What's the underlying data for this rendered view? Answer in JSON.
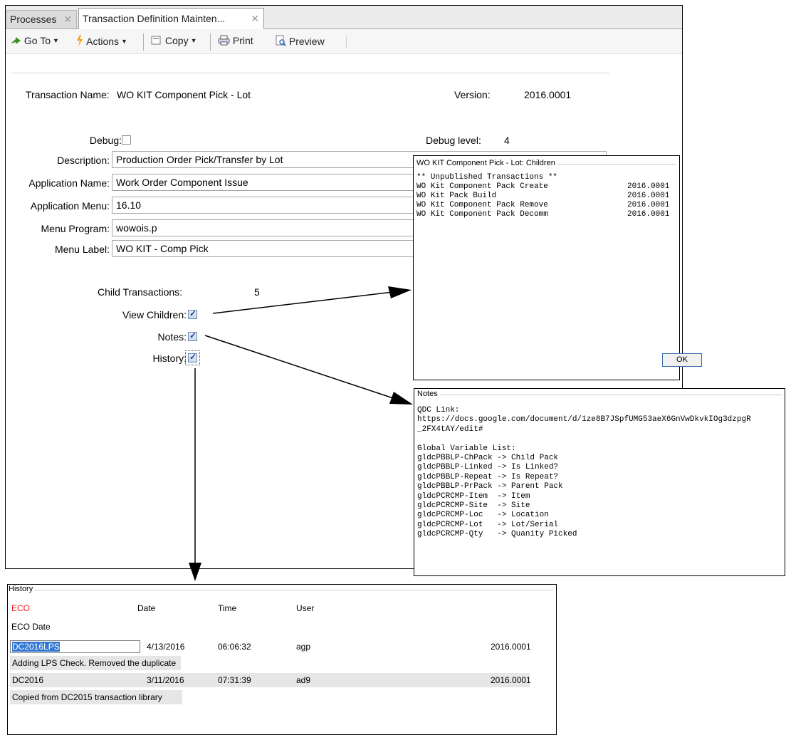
{
  "tabs": [
    {
      "label": "Processes"
    },
    {
      "label": "Transaction Definition Mainten..."
    }
  ],
  "toolbar": {
    "goto_label": "Go To",
    "actions_label": "Actions",
    "copy_label": "Copy",
    "print_label": "Print",
    "preview_label": "Preview"
  },
  "form": {
    "transaction_name_label": "Transaction Name:",
    "transaction_name_value": "WO KIT Component Pick - Lot",
    "version_label": "Version:",
    "version_value": "2016.0001",
    "debug_label": "Debug:",
    "debug_checked": false,
    "debug_level_label": "Debug level:",
    "debug_level_value": "4",
    "description_label": "Description:",
    "description_value": "Production Order Pick/Transfer by Lot",
    "application_name_label": "Application Name:",
    "application_name_value": "Work Order Component Issue",
    "application_menu_label": "Application Menu:",
    "application_menu_value": "16.10",
    "menu_program_label": "Menu Program:",
    "menu_program_value": "wowois.p",
    "menu_label_label": "Menu Label:",
    "menu_label_value": "WO KIT - Comp Pick",
    "child_transactions_label": "Child Transactions:",
    "child_transactions_value": "5",
    "view_children_label": "View Children:",
    "view_children_checked": true,
    "notes_label": "Notes:",
    "notes_checked": true,
    "history_label": "History:",
    "history_checked": true
  },
  "children_popup": {
    "title": "WO KIT Component Pick - Lot: Children",
    "header": "** Unpublished Transactions **",
    "items": [
      {
        "name": "WO Kit Component Pack Create",
        "version": "2016.0001"
      },
      {
        "name": "WO Kit Pack Build",
        "version": "2016.0001"
      },
      {
        "name": "WO Kit Component Pack Remove",
        "version": "2016.0001"
      },
      {
        "name": "WO Kit Component Pack Decomm",
        "version": "2016.0001"
      }
    ],
    "ok_label": "OK"
  },
  "notes_popup": {
    "title": "Notes",
    "lines": [
      "QDC Link:",
      "https://docs.google.com/document/d/1ze8B7JSpfUMG53aeX6GnVwDkvkIOg3dzpgR",
      "_2FX4tAY/edit#",
      "",
      "Global Variable List:",
      "gldcPBBLP-ChPack -> Child Pack",
      "gldcPBBLP-Linked -> Is Linked?",
      "gldcPBBLP-Repeat -> Is Repeat?",
      "gldcPBBLP-PrPack -> Parent Pack",
      "gldcPCRCMP-Item  -> Item",
      "gldcPCRCMP-Site  -> Site",
      "gldcPCRCMP-Loc   -> Location",
      "gldcPCRCMP-Lot   -> Lot/Serial",
      "gldcPCRCMP-Qty   -> Quanity Picked"
    ]
  },
  "history_popup": {
    "title": "History",
    "columns": {
      "eco": "ECO",
      "date": "Date",
      "time": "Time",
      "user": "User"
    },
    "sub_header": "ECO Date",
    "rows": [
      {
        "eco": "DC2016LPS",
        "date": "4/13/2016",
        "time": "06:06:32",
        "user": "agp",
        "version": "2016.0001",
        "comment": "Adding LPS Check. Removed the duplicate"
      },
      {
        "eco": "DC2016",
        "date": "3/11/2016",
        "time": "07:31:39",
        "user": "ad9",
        "version": "2016.0001",
        "comment": "Copied from DC2015 transaction library"
      }
    ],
    "eco_color": "#e8211c"
  },
  "colors": {
    "selection": "#3478d6",
    "goto_icon": "#3a8f1f",
    "actions_icon": "#f2a31b"
  }
}
